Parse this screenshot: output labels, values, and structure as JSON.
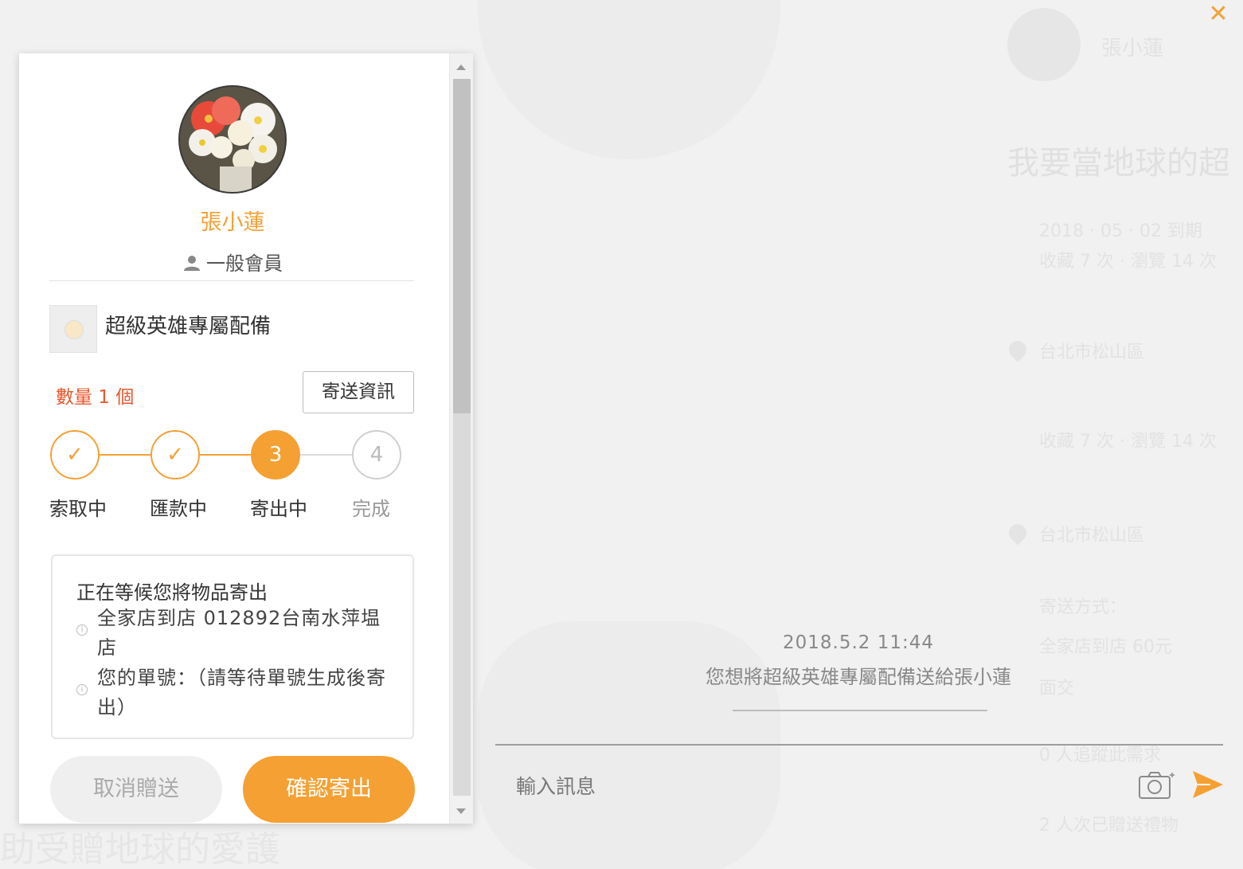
{
  "colors": {
    "accent": "#f5a033",
    "quantity": "#e8572d",
    "background": "#f1f1f1"
  },
  "close_icon": "close-icon",
  "background_page": {
    "name": "張小蓮",
    "title": "我要當地球的超",
    "lines": [
      "2018 · 05 · 02 到期",
      "收藏 7 次 · 瀏覽 14 次",
      "台北市松山區",
      "收藏 7 次 · 瀏覽 14 次",
      "台北市松山區",
      "寄送方式：",
      "全家店到店 60元",
      "面交",
      "0 人追蹤此需求",
      "2 人次已贈送禮物"
    ],
    "bottom_text": "助受贈地球的愛護"
  },
  "panel": {
    "user_name": "張小蓮",
    "member_level": "一般會員",
    "item_title": "超級英雄專屬配備",
    "quantity_text": "數量 1 個",
    "ship_info_label": "寄送資訊",
    "steps": [
      {
        "label": "索取中",
        "symbol": "✓",
        "state": "done"
      },
      {
        "label": "匯款中",
        "symbol": "✓",
        "state": "done"
      },
      {
        "label": "寄出中",
        "symbol": "3",
        "state": "active"
      },
      {
        "label": "完成",
        "symbol": "4",
        "state": "todo"
      }
    ],
    "status": {
      "title": "正在等候您將物品寄出",
      "store": "全家店到店 012892台南水萍塭店",
      "order_no": "您的單號：（請等待單號生成後寄出）"
    },
    "cancel_label": "取消贈送",
    "confirm_label": "確認寄出"
  },
  "chat": {
    "timestamp": "2018.5.2 11:44",
    "system_message": "您想將超級英雄專屬配備送給張小蓮",
    "input_placeholder": "輸入訊息"
  }
}
